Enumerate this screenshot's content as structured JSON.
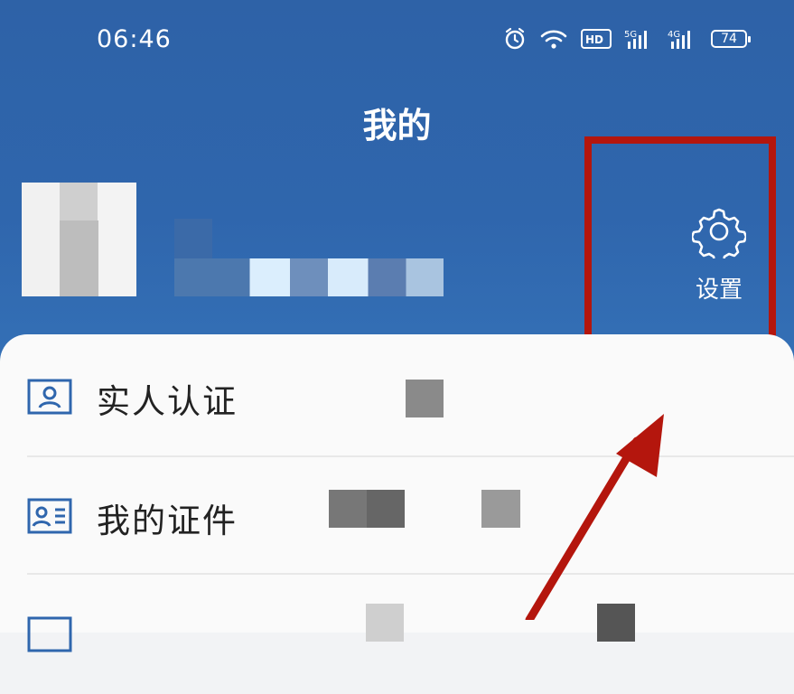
{
  "status_bar": {
    "time": "06:46",
    "battery": "74",
    "icons": [
      "alarm-icon",
      "wifi-icon",
      "hd-icon",
      "signal-5g-icon",
      "signal-4g-icon",
      "battery-icon"
    ]
  },
  "header": {
    "title": "我的",
    "settings_label": "设置",
    "background_color": "#2f66ad"
  },
  "menu": {
    "items": [
      {
        "label": "实人认证",
        "icon": "person-id-icon"
      },
      {
        "label": "我的证件",
        "icon": "id-card-icon"
      },
      {
        "label": "",
        "icon": "document-icon"
      }
    ]
  },
  "annotation": {
    "highlight_color": "#b4160d"
  }
}
